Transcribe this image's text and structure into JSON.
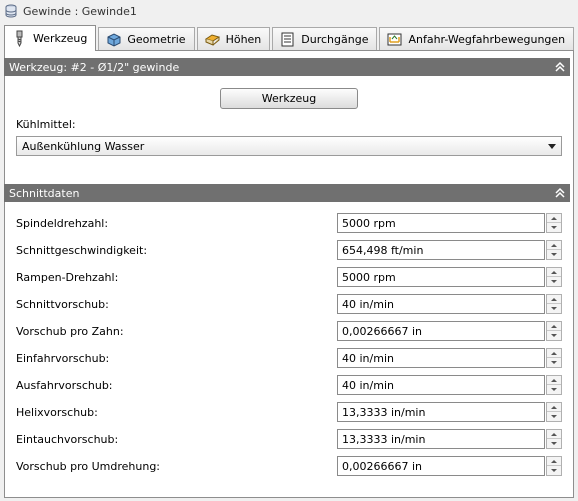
{
  "window": {
    "title": "Gewinde : Gewinde1",
    "icon": "database-icon"
  },
  "tabs": [
    {
      "label": "Werkzeug",
      "icon": "drill-tool-icon",
      "active": true
    },
    {
      "label": "Geometrie",
      "icon": "cube-icon",
      "active": false
    },
    {
      "label": "Höhen",
      "icon": "heights-icon",
      "active": false
    },
    {
      "label": "Durchgänge",
      "icon": "passes-icon",
      "active": false
    },
    {
      "label": "Anfahr-Wegfahrbewegungen",
      "icon": "linking-icon",
      "active": false
    }
  ],
  "tool_section": {
    "header": "Werkzeug: #2 - Ø1/2\" gewinde",
    "button_label": "Werkzeug",
    "coolant_label": "Kühlmittel:",
    "coolant_value": "Außenkühlung Wasser"
  },
  "cutting_section": {
    "header": "Schnittdaten",
    "rows": [
      {
        "label": "Spindeldrehzahl:",
        "value": "5000 rpm"
      },
      {
        "label": "Schnittgeschwindigkeit:",
        "value": "654,498 ft/min"
      },
      {
        "label": "Rampen-Drehzahl:",
        "value": "5000 rpm"
      },
      {
        "label": "Schnittvorschub:",
        "value": "40 in/min"
      },
      {
        "label": "Vorschub pro Zahn:",
        "value": "0,00266667 in"
      },
      {
        "label": "Einfahrvorschub:",
        "value": "40 in/min"
      },
      {
        "label": "Ausfahrvorschub:",
        "value": "40 in/min"
      },
      {
        "label": "Helixvorschub:",
        "value": "13,3333 in/min"
      },
      {
        "label": "Eintauchvorschub:",
        "value": "13,3333 in/min"
      },
      {
        "label": "Vorschub pro Umdrehung:",
        "value": "0,00266667 in"
      }
    ]
  },
  "colors": {
    "section_header": "#707070",
    "tab_active": "#ffffff",
    "accent_icon": "#e0a020"
  }
}
